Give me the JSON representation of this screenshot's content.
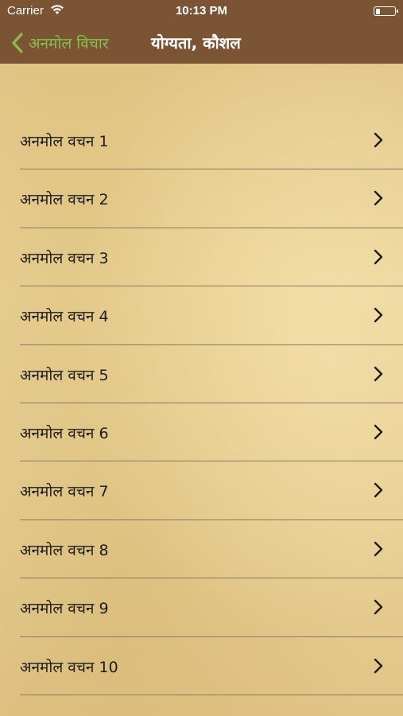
{
  "status_bar": {
    "carrier": "Carrier",
    "time": "10:13 PM",
    "icons": [
      "wifi-icon",
      "battery-icon"
    ]
  },
  "nav": {
    "back_label": "अनमोल विचार",
    "title": "योग्यता, कौशल",
    "back_icon": "chevron-left-icon"
  },
  "colors": {
    "bar": "#7b5434",
    "accent_green": "#88bf4b",
    "title": "#ffffff",
    "row_text": "#1d1d1d"
  },
  "list": {
    "row_icon": "chevron-right-icon",
    "items": [
      {
        "label": "अनमोल वचन 1"
      },
      {
        "label": "अनमोल वचन 2"
      },
      {
        "label": "अनमोल वचन 3"
      },
      {
        "label": "अनमोल वचन 4"
      },
      {
        "label": "अनमोल वचन 5"
      },
      {
        "label": "अनमोल वचन 6"
      },
      {
        "label": "अनमोल वचन 7"
      },
      {
        "label": "अनमोल वचन 8"
      },
      {
        "label": "अनमोल वचन 9"
      },
      {
        "label": "अनमोल वचन 10"
      }
    ]
  }
}
